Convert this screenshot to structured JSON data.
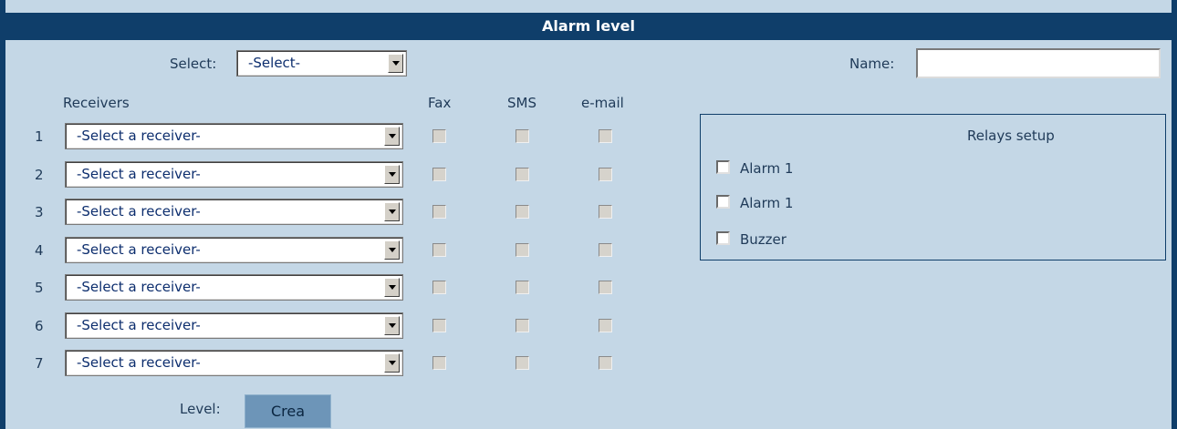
{
  "title": "Alarm level",
  "select_label": "Select:",
  "select_value": "-Select-",
  "name_label": "Name:",
  "name_value": "",
  "headers": {
    "receivers": "Receivers",
    "fax": "Fax",
    "sms": "SMS",
    "email": "e-mail"
  },
  "rows": [
    {
      "num": "1",
      "receiver": "-Select a receiver-"
    },
    {
      "num": "2",
      "receiver": "-Select a receiver-"
    },
    {
      "num": "3",
      "receiver": "-Select a receiver-"
    },
    {
      "num": "4",
      "receiver": "-Select a receiver-"
    },
    {
      "num": "5",
      "receiver": "-Select a receiver-"
    },
    {
      "num": "6",
      "receiver": "-Select a receiver-"
    },
    {
      "num": "7",
      "receiver": "-Select a receiver-"
    }
  ],
  "relays": {
    "title": "Relays setup",
    "items": [
      {
        "label": "Alarm 1"
      },
      {
        "label": "Alarm 1"
      },
      {
        "label": "Buzzer"
      }
    ]
  },
  "level_label": "Level:",
  "crea_label": "Crea"
}
